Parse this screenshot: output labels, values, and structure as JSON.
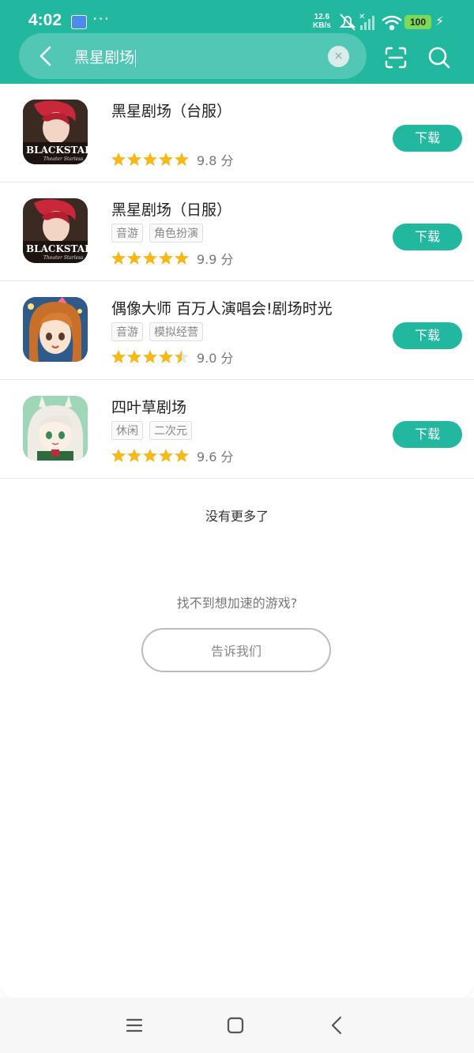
{
  "status_bar": {
    "time": "4:02",
    "speed_value": "12.6",
    "speed_unit": "KB/s",
    "battery": "100"
  },
  "search": {
    "query": "黑星剧场",
    "clear_glyph": "×"
  },
  "games": [
    {
      "title": "黑星剧场（台服）",
      "tags": [],
      "score": "9.8 分",
      "rating_stars": 5,
      "download_label": "下载",
      "icon": "black-star-icon"
    },
    {
      "title": "黑星剧场（日服）",
      "tags": [
        "音游",
        "角色扮演"
      ],
      "score": "9.9 分",
      "rating_stars": 5,
      "download_label": "下载",
      "icon": "black-star-icon"
    },
    {
      "title": "偶像大师 百万人演唱会!剧场时光",
      "tags": [
        "音游",
        "模拟经营"
      ],
      "score": "9.0 分",
      "rating_stars": 4.5,
      "download_label": "下载",
      "icon": "idolmaster-icon"
    },
    {
      "title": "四叶草剧场",
      "tags": [
        "休闲",
        "二次元"
      ],
      "score": "9.6 分",
      "rating_stars": 5,
      "download_label": "下载",
      "icon": "clover-theater-icon"
    }
  ],
  "footer": {
    "no_more": "没有更多了",
    "cant_find": "找不到想加速的游戏?",
    "tell_us": "告诉我们"
  },
  "colors": {
    "accent": "#22b8a0",
    "star": "#f7b91a"
  }
}
